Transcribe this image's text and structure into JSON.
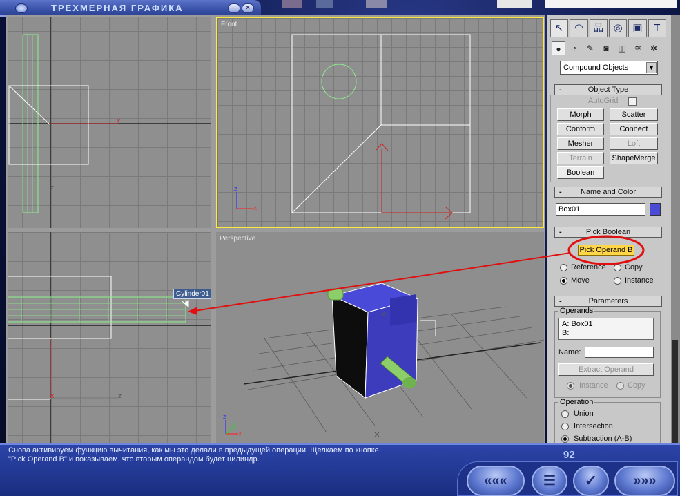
{
  "app": {
    "title": "ТРЕХМЕРНАЯ ГРАФИКА",
    "min_glyph": "–",
    "close_glyph": "×"
  },
  "viewports": {
    "front": {
      "label": "Front",
      "axis_x": "x",
      "axis_z": "z"
    },
    "perspective": {
      "label": "Perspective",
      "axis_x": "x",
      "axis_y": "y",
      "axis_z": "z"
    },
    "top_left": {
      "axis_x": "x",
      "axis_z": "z"
    },
    "bottom_left": {
      "axis_x": "x",
      "axis_z": "z",
      "tooltip": "Cylinder01"
    }
  },
  "panel": {
    "tabs": [
      {
        "icon": "pointer-icon",
        "glyph": "↖"
      },
      {
        "icon": "modify-icon",
        "glyph": "◠"
      },
      {
        "icon": "hierarchy-icon",
        "glyph": "品"
      },
      {
        "icon": "motion-icon",
        "glyph": "◎"
      },
      {
        "icon": "display-icon",
        "glyph": "▣"
      },
      {
        "icon": "utilities-icon",
        "glyph": "T"
      }
    ],
    "subtabs": [
      {
        "icon": "geometry-icon",
        "glyph": "●"
      },
      {
        "icon": "shapes-icon",
        "glyph": "◔"
      },
      {
        "icon": "lights-icon",
        "glyph": "✎"
      },
      {
        "icon": "cameras-icon",
        "glyph": "◙"
      },
      {
        "icon": "helpers-icon",
        "glyph": "◫"
      },
      {
        "icon": "spacewarps-icon",
        "glyph": "≋"
      },
      {
        "icon": "systems-icon",
        "glyph": "✲"
      }
    ],
    "category": "Compound Objects",
    "object_type": {
      "title": "Object Type",
      "minus": "-",
      "autogrid": "AutoGrid",
      "buttons": {
        "morph": "Morph",
        "scatter": "Scatter",
        "conform": "Conform",
        "connect": "Connect",
        "mesher": "Mesher",
        "loft": "Loft",
        "terrain": "Terrain",
        "shapemerge": "ShapeMerge",
        "boolean": "Boolean"
      }
    },
    "name_color": {
      "title": "Name and Color",
      "minus": "-",
      "name": "Box01"
    },
    "pick_boolean": {
      "title": "Pick Boolean",
      "minus": "-",
      "pick_button": "Pick Operand B",
      "reference": "Reference",
      "copy": "Copy",
      "move": "Move",
      "instance": "Instance"
    },
    "parameters": {
      "title": "Parameters",
      "minus": "-",
      "operands_label": "Operands",
      "operand_a": "A: Box01",
      "operand_b": "B:",
      "name_label": "Name:",
      "extract_button": "Extract Operand",
      "instance": "Instance",
      "copy": "Copy",
      "operation_label": "Operation",
      "union": "Union",
      "intersection": "Intersection",
      "subtraction": "Subtraction (A-B)"
    }
  },
  "bottom": {
    "text_line1": "Снова активируем функцию вычитания, как мы это делали в предыдущей операции. Щелкаем по кнопке",
    "text_line2": "\"Pick Operand B\" и показываем, что вторым операндом будет цилиндр.",
    "page": "92",
    "nav": {
      "prev": "«««",
      "menu": "☰",
      "check": "✓",
      "next": "»»»"
    }
  },
  "colors": {
    "accent_yellow": "#ffd54a",
    "highlight_red": "#e01010",
    "box_blue": "#4040c8",
    "cylinder_green": "#8ccf6a"
  }
}
